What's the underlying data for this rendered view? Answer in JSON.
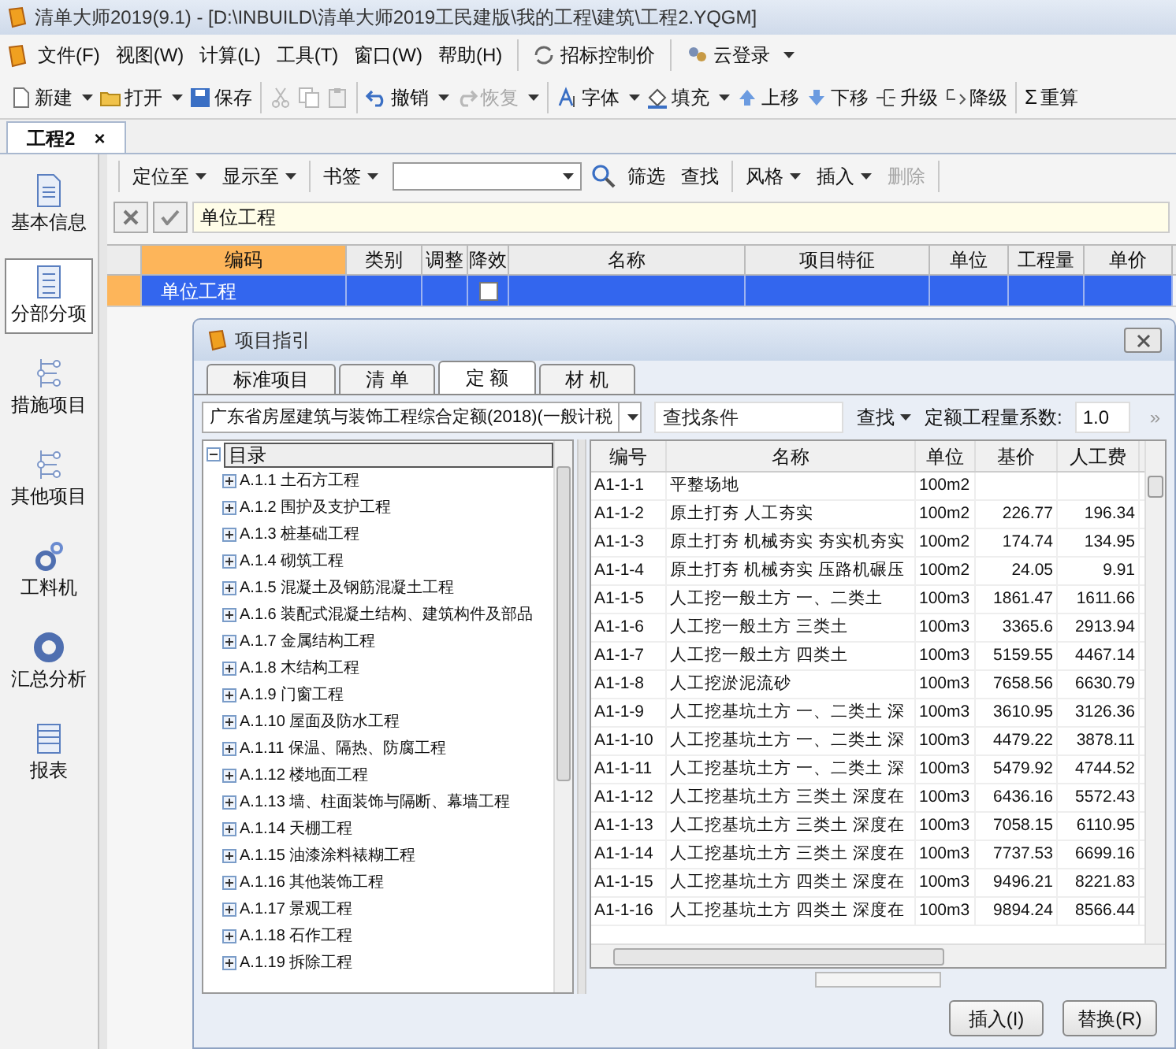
{
  "window": {
    "title": "清单大师2019(9.1) - [D:\\INBUILD\\清单大师2019工民建版\\我的工程\\建筑\\工程2.YQGM]"
  },
  "menu": {
    "items": [
      "文件(F)",
      "视图(W)",
      "计算(L)",
      "工具(T)",
      "窗口(W)",
      "帮助(H)"
    ],
    "extras": [
      {
        "label": "招标控制价",
        "dropdown": false
      },
      {
        "label": "云登录",
        "dropdown": true
      }
    ]
  },
  "toolbar": [
    [
      {
        "label": "新建",
        "dropdown": true,
        "disabled": false
      },
      {
        "label": "打开",
        "dropdown": true,
        "disabled": false
      },
      {
        "label": "保存",
        "dropdown": false,
        "disabled": false
      }
    ],
    [
      {
        "dropdown": false,
        "disabled": true
      },
      {
        "dropdown": false,
        "disabled": true
      },
      {
        "dropdown": false,
        "disabled": true
      }
    ],
    [
      {
        "label": "撤销",
        "dropdown": true,
        "disabled": false
      },
      {
        "label": "恢复",
        "dropdown": true,
        "disabled": true
      }
    ],
    [
      {
        "label": "字体",
        "dropdown": true,
        "disabled": false
      },
      {
        "label": "填充",
        "dropdown": true,
        "disabled": false
      },
      {
        "label": "上移",
        "dropdown": false,
        "disabled": false
      },
      {
        "label": "下移",
        "dropdown": false,
        "disabled": false
      },
      {
        "label": "升级",
        "dropdown": false,
        "disabled": false
      },
      {
        "label": "降级",
        "dropdown": false,
        "disabled": false
      }
    ],
    [
      {
        "symbol": "Σ",
        "label": "重算",
        "dropdown": false,
        "disabled": false
      }
    ]
  ],
  "doc_tabs": [
    {
      "label": "工程2",
      "selected": true,
      "close": "×"
    }
  ],
  "sidebar": [
    {
      "label": "基本信息",
      "selected": false
    },
    {
      "label": "分部分项",
      "selected": true
    },
    {
      "label": "措施项目",
      "selected": false
    },
    {
      "label": "其他项目",
      "selected": false
    },
    {
      "label": "工料机",
      "selected": false
    },
    {
      "label": "汇总分析",
      "selected": false
    },
    {
      "label": "报表",
      "selected": false
    }
  ],
  "sub_toolbar": [
    [
      {
        "kind": "menu",
        "label": "定位至",
        "disabled": false
      },
      {
        "kind": "menu",
        "label": "显示至",
        "disabled": false
      }
    ],
    [
      {
        "kind": "menu",
        "label": "书签",
        "disabled": false
      },
      {
        "kind": "combo",
        "disabled": false
      },
      {
        "kind": "search",
        "disabled": false
      },
      {
        "kind": "button",
        "label": "筛选",
        "disabled": false
      },
      {
        "kind": "button",
        "label": "查找",
        "disabled": false
      }
    ],
    [
      {
        "kind": "menu",
        "label": "风格",
        "disabled": false
      },
      {
        "kind": "menu",
        "label": "插入",
        "disabled": false
      },
      {
        "kind": "button",
        "label": "删除",
        "disabled": true
      }
    ]
  ],
  "formula_bar": {
    "value": "单位工程"
  },
  "grid": {
    "columns": [
      {
        "label": "编码",
        "selected": true
      },
      {
        "label": "类别",
        "selected": false
      },
      {
        "label": "调整",
        "selected": false
      },
      {
        "label": "降效",
        "selected": false
      },
      {
        "label": "名称",
        "selected": false
      },
      {
        "label": "项目特征",
        "selected": false
      },
      {
        "label": "单位",
        "selected": false
      },
      {
        "label": "工程量",
        "selected": false
      },
      {
        "label": "单价",
        "selected": false
      }
    ],
    "rows": [
      {
        "selected": true,
        "code": "单位工程",
        "reduce_checked": false
      }
    ]
  },
  "dialog": {
    "title": "项目指引",
    "tabs": [
      {
        "label": "标准项目",
        "selected": false
      },
      {
        "label": "清 单",
        "selected": false
      },
      {
        "label": "定 额",
        "selected": true
      },
      {
        "label": "材 机",
        "selected": false
      }
    ],
    "library": "广东省房屋建筑与装饰工程综合定额(2018)(一般计税",
    "search_placeholder": "查找条件",
    "find": "查找",
    "factor_label": "定额工程量系数:",
    "factor_value": "1.0",
    "more": "»",
    "tree": {
      "label": "目录",
      "expanded": true,
      "selected": true,
      "children": [
        {
          "code": "A.1.1",
          "label": "土石方工程",
          "expanded": false
        },
        {
          "code": "A.1.2",
          "label": "围护及支护工程",
          "expanded": false
        },
        {
          "code": "A.1.3",
          "label": "桩基础工程",
          "expanded": false
        },
        {
          "code": "A.1.4",
          "label": "砌筑工程",
          "expanded": false
        },
        {
          "code": "A.1.5",
          "label": "混凝土及钢筋混凝土工程",
          "expanded": false
        },
        {
          "code": "A.1.6",
          "label": "装配式混凝土结构、建筑构件及部品",
          "expanded": false
        },
        {
          "code": "A.1.7",
          "label": "金属结构工程",
          "expanded": false
        },
        {
          "code": "A.1.8",
          "label": "木结构工程",
          "expanded": false
        },
        {
          "code": "A.1.9",
          "label": "门窗工程",
          "expanded": false
        },
        {
          "code": "A.1.10",
          "label": "屋面及防水工程",
          "expanded": false
        },
        {
          "code": "A.1.11",
          "label": "保温、隔热、防腐工程",
          "expanded": false
        },
        {
          "code": "A.1.12",
          "label": "楼地面工程",
          "expanded": false
        },
        {
          "code": "A.1.13",
          "label": "墙、柱面装饰与隔断、幕墙工程",
          "expanded": false
        },
        {
          "code": "A.1.14",
          "label": "天棚工程",
          "expanded": false
        },
        {
          "code": "A.1.15",
          "label": "油漆涂料裱糊工程",
          "expanded": false
        },
        {
          "code": "A.1.16",
          "label": "其他装饰工程",
          "expanded": false
        },
        {
          "code": "A.1.17",
          "label": "景观工程",
          "expanded": false
        },
        {
          "code": "A.1.18",
          "label": "石作工程",
          "expanded": false
        },
        {
          "code": "A.1.19",
          "label": "拆除工程",
          "expanded": false
        }
      ]
    },
    "table": {
      "columns": [
        "编号",
        "名称",
        "单位",
        "基价",
        "人工费"
      ],
      "rows": [
        [
          "A1-1-1",
          "平整场地",
          "100m2",
          "",
          ""
        ],
        [
          "A1-1-2",
          "原土打夯 人工夯实",
          "100m2",
          "226.77",
          "196.34"
        ],
        [
          "A1-1-3",
          "原土打夯 机械夯实 夯实机夯实",
          "100m2",
          "174.74",
          "134.95"
        ],
        [
          "A1-1-4",
          "原土打夯 机械夯实 压路机碾压",
          "100m2",
          "24.05",
          "9.91"
        ],
        [
          "A1-1-5",
          "人工挖一般土方 一、二类土",
          "100m3",
          "1861.47",
          "1611.66"
        ],
        [
          "A1-1-6",
          "人工挖一般土方 三类土",
          "100m3",
          "3365.6",
          "2913.94"
        ],
        [
          "A1-1-7",
          "人工挖一般土方 四类土",
          "100m3",
          "5159.55",
          "4467.14"
        ],
        [
          "A1-1-8",
          "人工挖淤泥流砂",
          "100m3",
          "7658.56",
          "6630.79"
        ],
        [
          "A1-1-9",
          "人工挖基坑土方 一、二类土 深",
          "100m3",
          "3610.95",
          "3126.36"
        ],
        [
          "A1-1-10",
          "人工挖基坑土方 一、二类土 深",
          "100m3",
          "4479.22",
          "3878.11"
        ],
        [
          "A1-1-11",
          "人工挖基坑土方 一、二类土 深",
          "100m3",
          "5479.92",
          "4744.52"
        ],
        [
          "A1-1-12",
          "人工挖基坑土方 三类土 深度在",
          "100m3",
          "6436.16",
          "5572.43"
        ],
        [
          "A1-1-13",
          "人工挖基坑土方 三类土 深度在",
          "100m3",
          "7058.15",
          "6110.95"
        ],
        [
          "A1-1-14",
          "人工挖基坑土方 三类土 深度在",
          "100m3",
          "7737.53",
          "6699.16"
        ],
        [
          "A1-1-15",
          "人工挖基坑土方 四类土 深度在",
          "100m3",
          "9496.21",
          "8221.83"
        ],
        [
          "A1-1-16",
          "人工挖基坑土方 四类土 深度在",
          "100m3",
          "9894.24",
          "8566.44"
        ]
      ]
    },
    "buttons": [
      "插入(I)",
      "替换(R)"
    ]
  }
}
